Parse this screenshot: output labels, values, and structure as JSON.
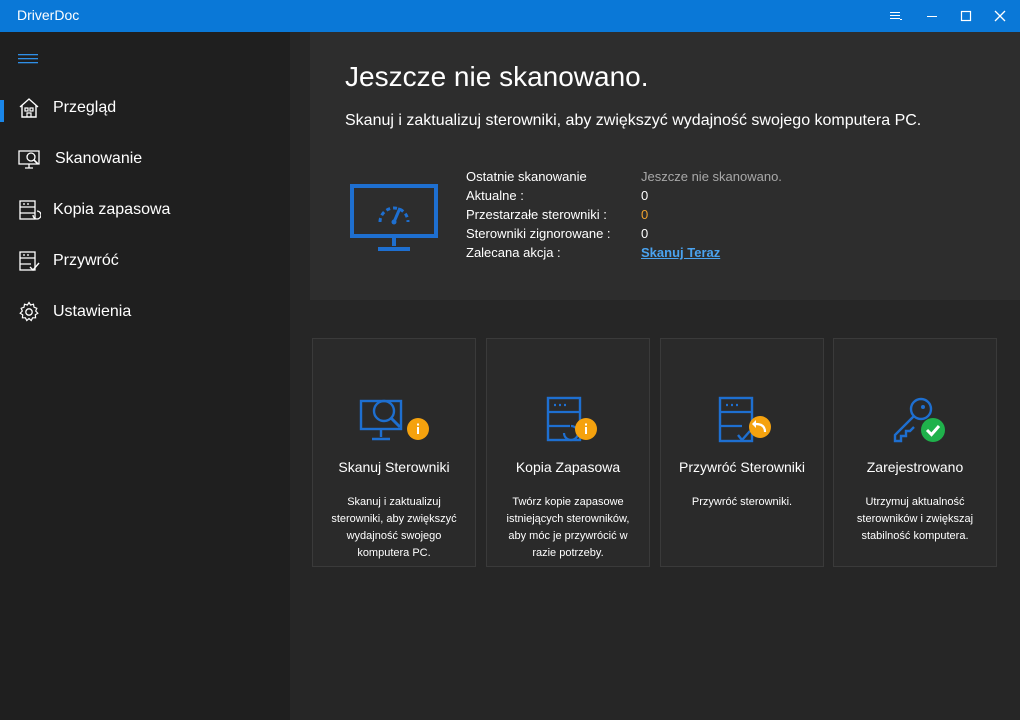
{
  "window": {
    "title": "DriverDoc",
    "title_bg": "#0a78d7"
  },
  "sidebar": {
    "items": [
      {
        "label": "Przegląd",
        "icon": "home-icon",
        "selected": true
      },
      {
        "label": "Skanowanie",
        "icon": "scan-icon",
        "selected": false
      },
      {
        "label": "Kopia zapasowa",
        "icon": "backup-icon",
        "selected": false
      },
      {
        "label": "Przywróć",
        "icon": "restore-icon",
        "selected": false
      },
      {
        "label": "Ustawienia",
        "icon": "gear-icon",
        "selected": false
      }
    ],
    "accent": "#1a86e8"
  },
  "overview": {
    "heading": "Jeszcze nie skanowano.",
    "subheading": "Skanuj i zaktualizuj sterowniki, aby zwiększyć wydajność swojego komputera PC.",
    "info": [
      {
        "key": "Ostatnie skanowanie",
        "value": "Jeszcze nie skanowano."
      },
      {
        "key": "Aktualne :",
        "value": "0"
      },
      {
        "key": "Przestarzałe sterowniki :",
        "value": "0"
      },
      {
        "key": "Sterowniki zignorowane :",
        "value": "0"
      },
      {
        "key": "Zalecana akcja :",
        "value": "Skanuj Teraz"
      }
    ],
    "warning_color": "#f0a22e",
    "link_color": "#4aa3f0"
  },
  "cards": [
    {
      "title": "Skanuj Sterowniki",
      "desc": "Skanuj i zaktualizuj sterowniki, aby zwiększyć wydajność swojego komputera PC.",
      "icon": "scan-drivers-icon",
      "badge": "info-badge-icon"
    },
    {
      "title": "Kopia Zapasowa",
      "desc": "Twórz kopie zapasowe istniejących sterowników, aby móc je przywrócić w razie potrzeby.",
      "icon": "backup-drivers-icon",
      "badge": "info-badge-icon"
    },
    {
      "title": "Przywróć Sterowniki",
      "desc": "Przywróć sterowniki.",
      "icon": "restore-drivers-icon",
      "badge": "undo-badge-icon"
    },
    {
      "title": "Zarejestrowano",
      "desc": "Utrzymuj aktualność sterowników i zwiększaj stabilność komputera.",
      "icon": "key-icon",
      "badge": "check-badge-icon"
    }
  ],
  "colors": {
    "icon_blue": "#1e6fd0",
    "badge_orange": "#f5a20e",
    "badge_green": "#1fb14b"
  }
}
